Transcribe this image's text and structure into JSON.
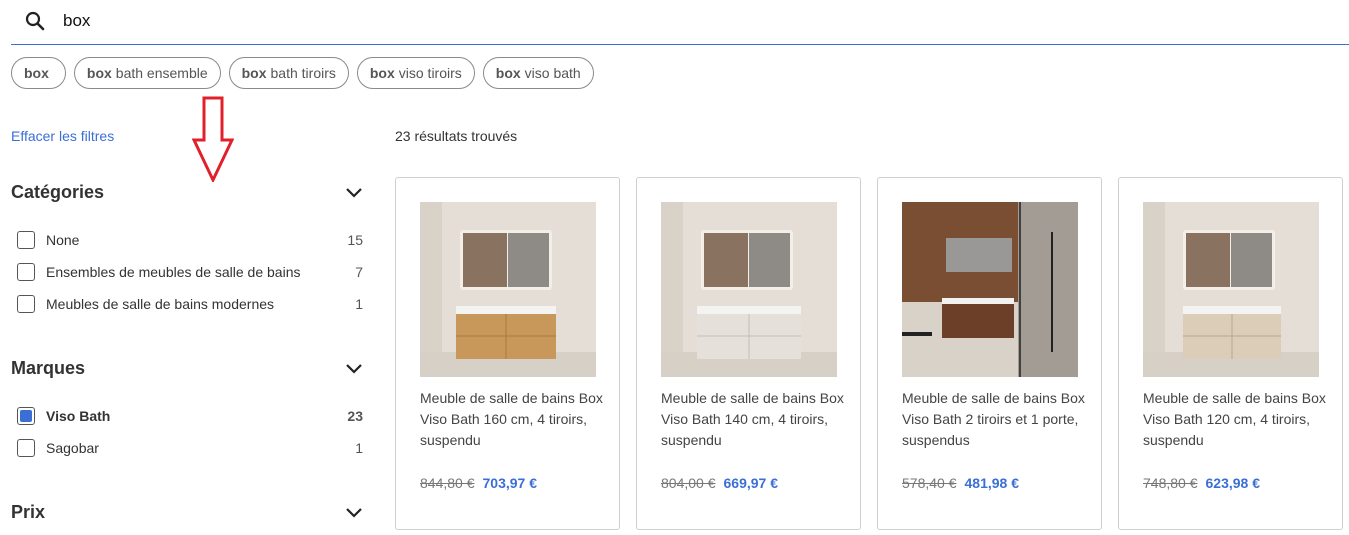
{
  "search": {
    "value": "box"
  },
  "suggestions": [
    {
      "bold": "box",
      "rest": ""
    },
    {
      "bold": "box",
      "rest": "bath ensemble"
    },
    {
      "bold": "box",
      "rest": "bath tiroirs"
    },
    {
      "bold": "box",
      "rest": "viso tiroirs"
    },
    {
      "bold": "box",
      "rest": "viso bath"
    }
  ],
  "filters": {
    "clear_label": "Effacer les filtres",
    "categories": {
      "title": "Catégories",
      "items": [
        {
          "label": "None",
          "count": "15",
          "checked": false
        },
        {
          "label": "Ensembles de meubles de salle de bains",
          "count": "7",
          "checked": false
        },
        {
          "label": "Meubles de salle de bains modernes",
          "count": "1",
          "checked": false
        }
      ]
    },
    "brands": {
      "title": "Marques",
      "items": [
        {
          "label": "Viso Bath",
          "count": "23",
          "checked": true
        },
        {
          "label": "Sagobar",
          "count": "1",
          "checked": false
        }
      ]
    },
    "price": {
      "title": "Prix"
    }
  },
  "results": {
    "count_text": "23 résultats trouvés",
    "products": [
      {
        "title": "Meuble de salle de bains Box Viso Bath 160 cm, 4 tiroirs, suspendu",
        "old_price": "844,80 €",
        "price": "703,97 €",
        "finish": "oak"
      },
      {
        "title": "Meuble de salle de bains Box Viso Bath 140 cm, 4 tiroirs, suspendu",
        "old_price": "804,00 €",
        "price": "669,97 €",
        "finish": "white"
      },
      {
        "title": "Meuble de salle de bains Box Viso Bath 2 tiroirs et 1 porte, suspendus",
        "old_price": "578,40 €",
        "price": "481,98 €",
        "finish": "walnut"
      },
      {
        "title": "Meuble de salle de bains Box Viso Bath 120 cm, 4 tiroirs, suspendu",
        "old_price": "748,80 €",
        "price": "623,98 €",
        "finish": "light"
      }
    ]
  },
  "colors": {
    "accent": "#3b6fd6",
    "annotation_arrow": "#e0202a"
  }
}
